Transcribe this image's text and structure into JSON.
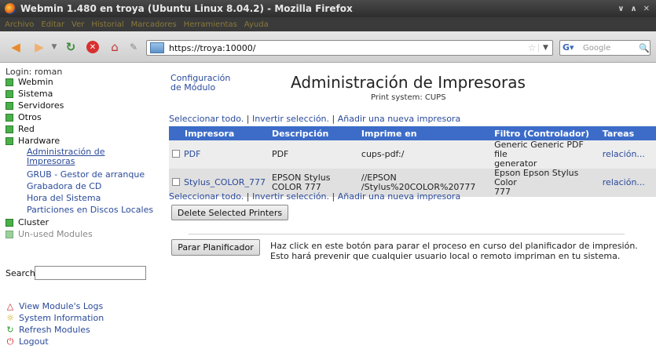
{
  "window": {
    "title": "Webmin 1.480 en troya (Ubuntu Linux 8.04.2) - Mozilla Firefox",
    "menu": [
      "Archivo",
      "Editar",
      "Ver",
      "Historial",
      "Marcadores",
      "Herramientas",
      "Ayuda"
    ]
  },
  "toolbar": {
    "url": "https://troya:10000/",
    "search_placeholder": "Google"
  },
  "sidebar": {
    "login": "Login: roman",
    "categories": [
      "Webmin",
      "Sistema",
      "Servidores",
      "Otros",
      "Red",
      "Hardware"
    ],
    "hardware_modules": [
      "Administración de Impresoras",
      "GRUB - Gestor de arranque",
      "Grabadora de CD",
      "Hora del Sistema",
      "Particiones en Discos Locales"
    ],
    "cluster": "Cluster",
    "unused": "Un-used Modules",
    "search_label": "Search:",
    "links": [
      "View Module's Logs",
      "System Information",
      "Refresh Modules",
      "Logout"
    ]
  },
  "main": {
    "config_link_line1": "Configuración",
    "config_link_line2": "de Módulo",
    "title": "Administración de Impresoras",
    "subtitle": "Print system: CUPS",
    "actions": [
      "Seleccionar todo.",
      "Invertir selección.",
      "Añadir una nueva impresora"
    ],
    "table": {
      "headers": [
        "Impresora",
        "Descripción",
        "Imprime en",
        "Filtro (Controlador)",
        "Tareas"
      ],
      "rows": [
        {
          "name": "PDF",
          "desc1": "PDF",
          "desc2": "",
          "prints1": "cups-pdf:/",
          "prints2": "",
          "filter1": "Generic Generic PDF file",
          "filter2": "generator",
          "tasks": "relación..."
        },
        {
          "name": "Stylus_COLOR_777",
          "desc1": "EPSON Stylus",
          "desc2": "COLOR 777",
          "prints1": "//EPSON",
          "prints2": "/Stylus%20COLOR%20777",
          "filter1": "Epson Epson Stylus Color",
          "filter2": "777",
          "tasks": "relación..."
        }
      ]
    },
    "delete_button": "Delete Selected Printers",
    "stop_button": "Parar Planificador",
    "stop_text1": "Haz click en este botón para parar el proceso en curso del planificador de impresión.",
    "stop_text2": "Esto hará prevenir que cualquier usuario local o remoto impriman en tu sistema."
  }
}
